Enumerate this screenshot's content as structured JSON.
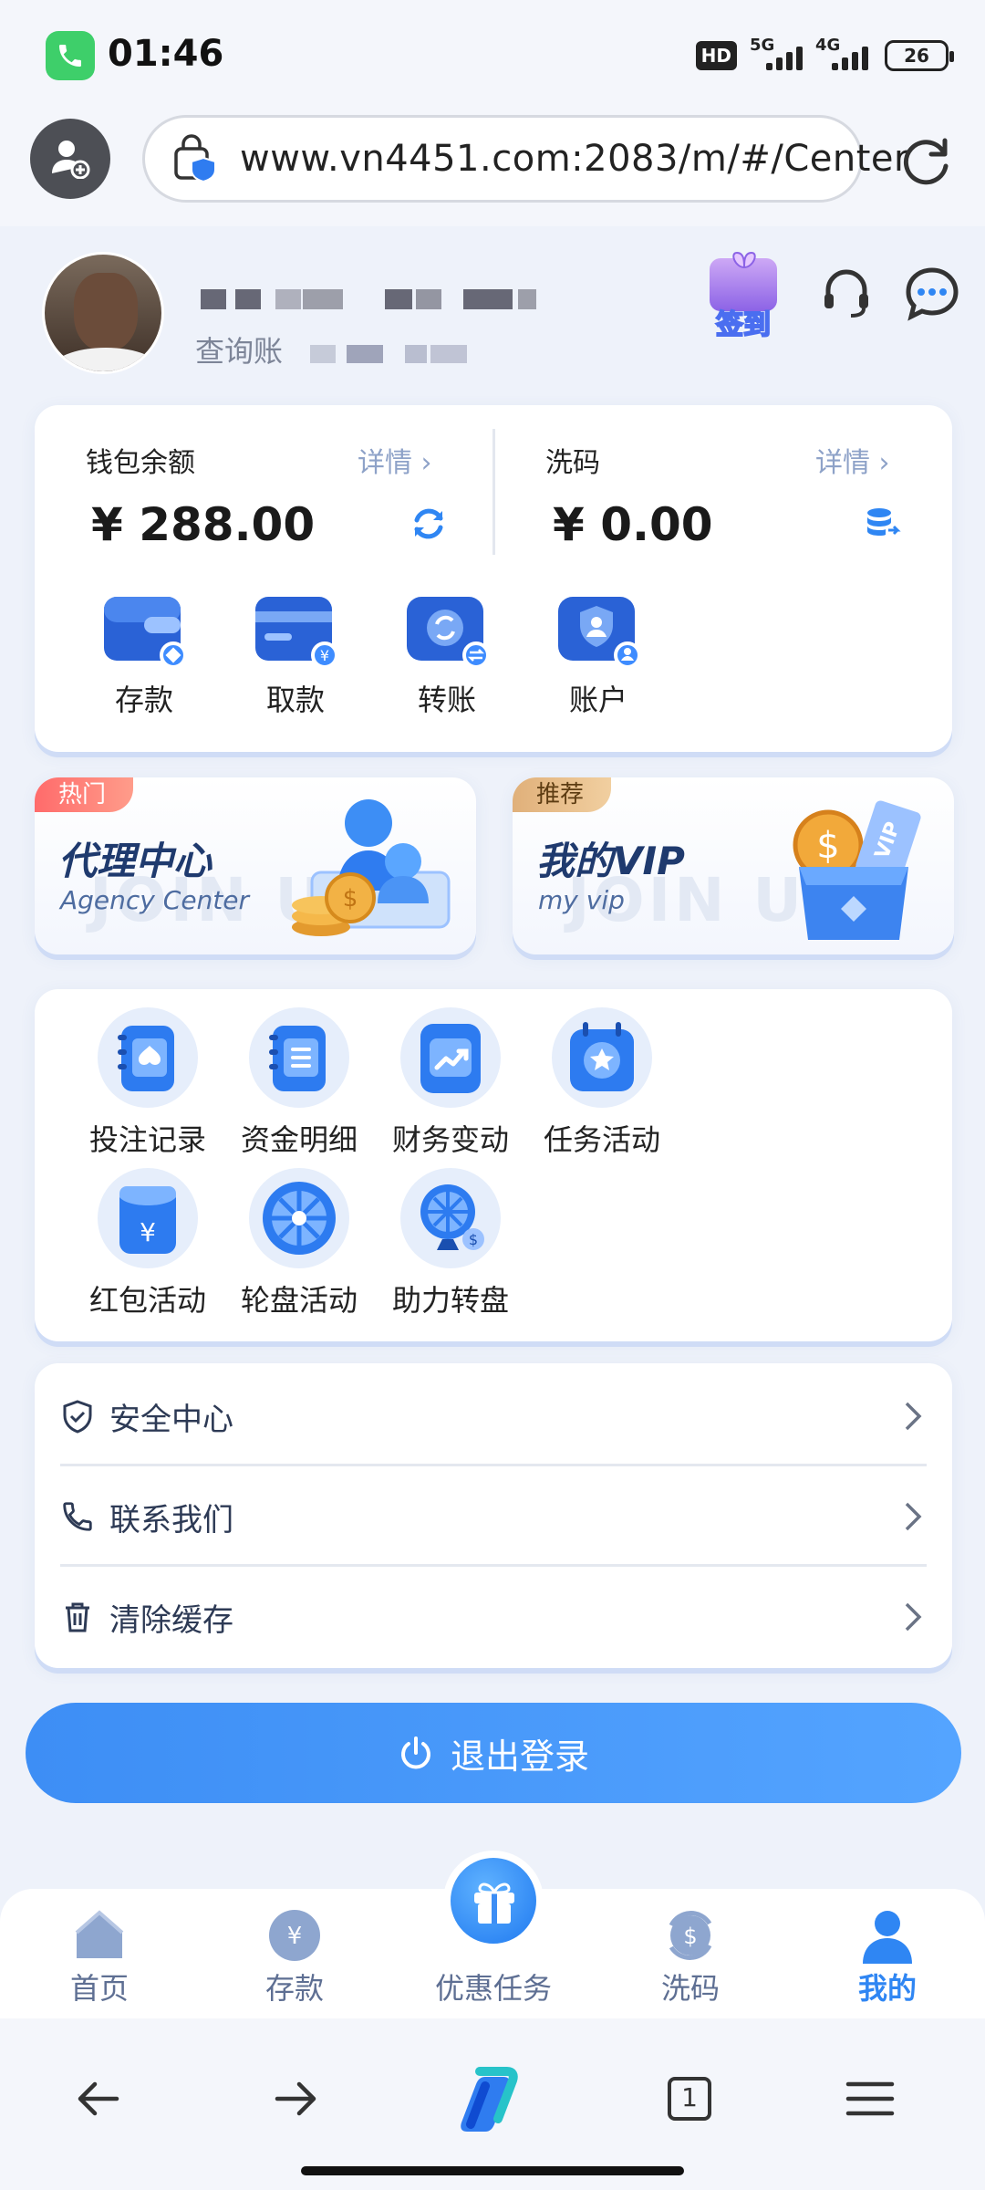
{
  "status_bar": {
    "time": "01:46",
    "hd_label": "HD",
    "net1": "5G",
    "net2": "4G",
    "battery": "26"
  },
  "browser": {
    "url": "www.vn4451.com:2083/m/#/Center",
    "tab_count": "1"
  },
  "profile": {
    "account_label": "查询账"
  },
  "header_actions": {
    "signin_label": "签到"
  },
  "wallet": {
    "balance_title": "钱包余额",
    "balance_detail": "详情 ›",
    "balance_amount": "¥ 288.00",
    "rebate_title": "洗码",
    "rebate_detail": "详情 ›",
    "rebate_amount": "¥ 0.00",
    "actions": [
      {
        "label": "存款",
        "icon": "wallet-deposit-icon"
      },
      {
        "label": "取款",
        "icon": "card-withdraw-icon"
      },
      {
        "label": "转账",
        "icon": "transfer-icon"
      },
      {
        "label": "账户",
        "icon": "account-icon"
      }
    ]
  },
  "banners": {
    "agency": {
      "badge": "热门",
      "title": "代理中心",
      "subtitle": "Agency Center",
      "watermark": "JOIN US"
    },
    "vip": {
      "badge": "推荐",
      "title": "我的VIP",
      "subtitle": "my vip",
      "watermark": "JOIN US"
    }
  },
  "services": [
    {
      "label": "投注记录",
      "icon": "bet-record-icon"
    },
    {
      "label": "资金明细",
      "icon": "fund-detail-icon"
    },
    {
      "label": "财务变动",
      "icon": "finance-change-icon"
    },
    {
      "label": "任务活动",
      "icon": "task-activity-icon"
    },
    {
      "label": "红包活动",
      "icon": "red-packet-icon"
    },
    {
      "label": "轮盘活动",
      "icon": "wheel-activity-icon"
    },
    {
      "label": "助力转盘",
      "icon": "assist-wheel-icon"
    }
  ],
  "menu": [
    {
      "label": "安全中心",
      "icon": "shield-icon"
    },
    {
      "label": "联系我们",
      "icon": "phone-icon"
    },
    {
      "label": "清除缓存",
      "icon": "trash-icon"
    }
  ],
  "logout_label": "退出登录",
  "bottom_nav": {
    "home": "首页",
    "deposit": "存款",
    "promo": "优惠任务",
    "rebate": "洗码",
    "mine": "我的"
  },
  "colors": {
    "accent": "#2f86f3",
    "background": "#eef2fa",
    "hot_badge": "#ff6b6b",
    "recommend_badge": "#e0b07a"
  }
}
